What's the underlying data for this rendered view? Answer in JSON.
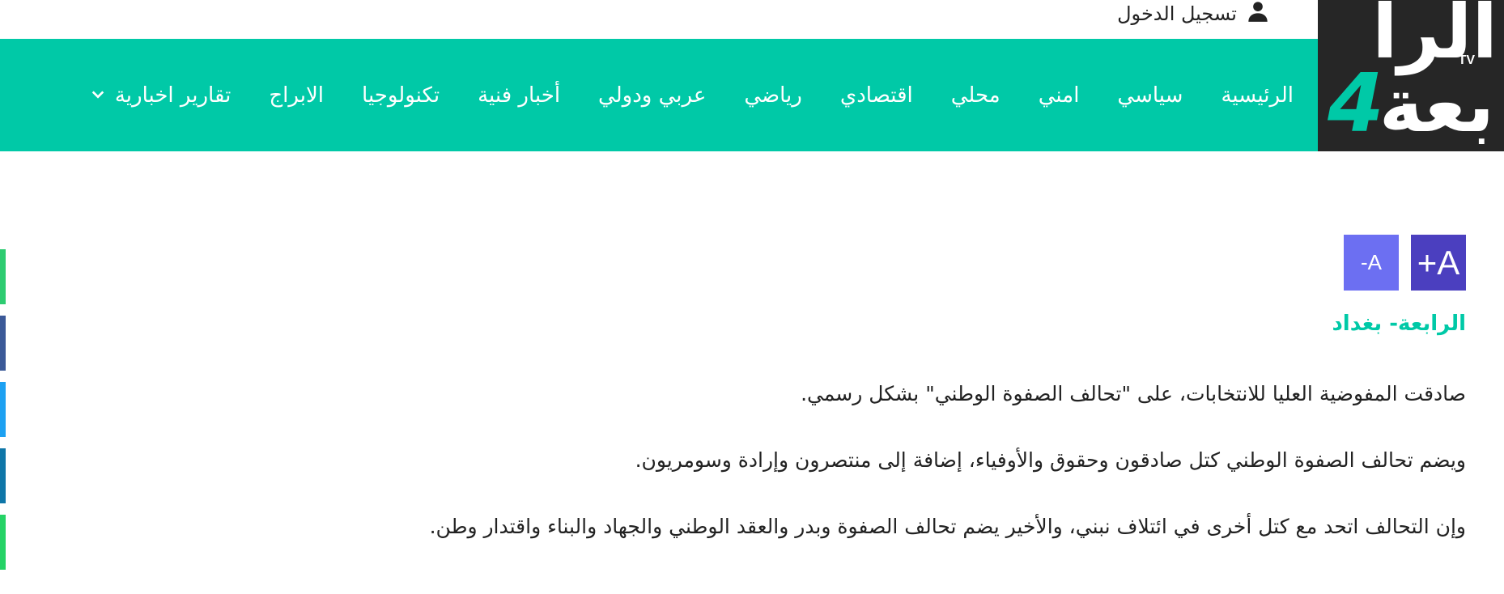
{
  "header": {
    "login_label": "تسجيل الدخول",
    "login_icon": "user-icon"
  },
  "logo": {
    "line1": "الرا",
    "line2": "بعة",
    "digit": "4",
    "tv": "TV",
    "colors": {
      "background": "#262626",
      "accent": "#00c9a7"
    }
  },
  "nav": {
    "items": [
      {
        "label": "الرئيسية"
      },
      {
        "label": "سياسي"
      },
      {
        "label": "امني"
      },
      {
        "label": "محلي"
      },
      {
        "label": "اقتصادي"
      },
      {
        "label": "رياضي"
      },
      {
        "label": "عربي ودولي"
      },
      {
        "label": "أخبار فنية"
      },
      {
        "label": "تكنولوجيا"
      },
      {
        "label": "الابراج"
      },
      {
        "label": "تقارير اخبارية",
        "has_dropdown": true,
        "icon": "chevron-down-icon"
      }
    ],
    "background": "#00c9a7"
  },
  "font_controls": {
    "increase_label": "A+",
    "decrease_label": "A-",
    "colors": {
      "increase": "#4b3fbf",
      "decrease": "#6c6ff2"
    }
  },
  "article": {
    "dateline": "الرابعة- بغداد",
    "paragraphs": [
      "صادقت المفوضية العليا للانتخابات، على \"تحالف الصفوة الوطني\" بشكل رسمي.",
      "ويضم تحالف الصفوة الوطني كتل صادقون وحقوق والأوفياء، إضافة إلى منتصرون وإرادة وسومريون.",
      "وإن التحالف اتحد مع كتل أخرى في ائتلاف نبني، والأخير يضم تحالف الصفوة وبدر والعقد الوطني والجهاد والبناء واقتدار وطن."
    ]
  },
  "share_bar": {
    "colors": [
      "#2ecc71",
      "#3b5998",
      "#1da1f2",
      "#0e76a8",
      "#25d366"
    ]
  }
}
